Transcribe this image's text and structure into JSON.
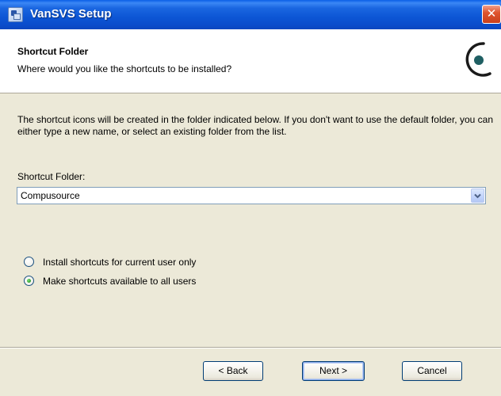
{
  "window": {
    "title": "VanSVS Setup",
    "close_glyph": "✕"
  },
  "header": {
    "title": "Shortcut Folder",
    "subtitle": "Where would you like the shortcuts to be installed?",
    "logo_icon": "installer-logo-icon"
  },
  "content": {
    "description": "The shortcut icons will be created in the folder indicated below. If you don't want to use the default folder, you can either type a new name, or select an existing folder from the list.",
    "field_label": "Shortcut Folder:",
    "folder_value": "Compusource",
    "radios": [
      {
        "label": "Install shortcuts for current user only",
        "selected": false
      },
      {
        "label": "Make shortcuts available to all users",
        "selected": true
      }
    ]
  },
  "buttons": {
    "back": "< Back",
    "next": "Next >",
    "cancel": "Cancel"
  },
  "colors": {
    "titlebar": "#0a55d4",
    "dialog_bg": "#ece9d8",
    "close_red": "#e0552f",
    "logo_teal": "#1f5f63"
  }
}
